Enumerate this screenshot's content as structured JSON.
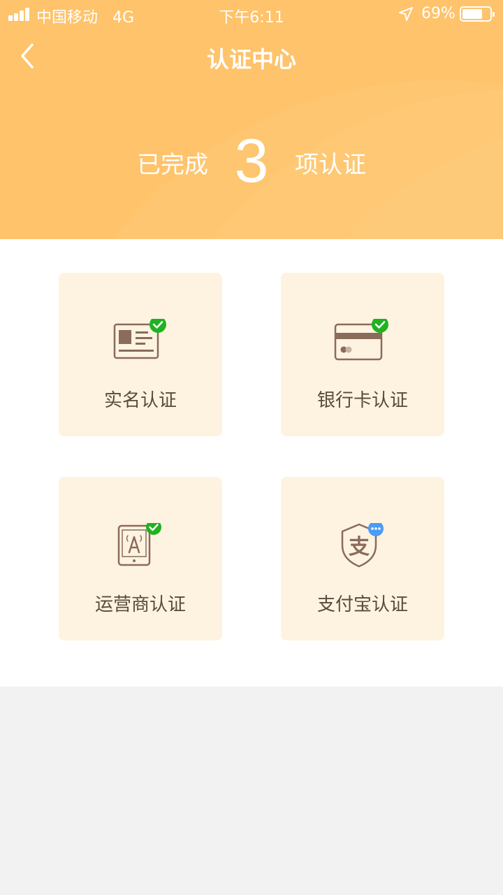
{
  "status_bar": {
    "carrier": "中国移动",
    "network": "4G",
    "time": "下午6:11",
    "battery": "69%"
  },
  "header": {
    "title": "认证中心",
    "summary_prefix": "已完成",
    "completed_count": "3",
    "summary_suffix": "项认证"
  },
  "verifications": [
    {
      "label": "实名认证",
      "icon": "id-card-icon",
      "status": "verified"
    },
    {
      "label": "银行卡认证",
      "icon": "bank-card-icon",
      "status": "verified"
    },
    {
      "label": "运营商认证",
      "icon": "carrier-phone-icon",
      "status": "verified"
    },
    {
      "label": "支付宝认证",
      "icon": "alipay-icon",
      "status": "pending"
    }
  ],
  "colors": {
    "header_bg": "#fec36b",
    "card_bg": "#fef3e1",
    "verified_green": "#1fb31f",
    "pending_blue": "#4a9cf5",
    "icon_brown": "#8b6b5a"
  }
}
